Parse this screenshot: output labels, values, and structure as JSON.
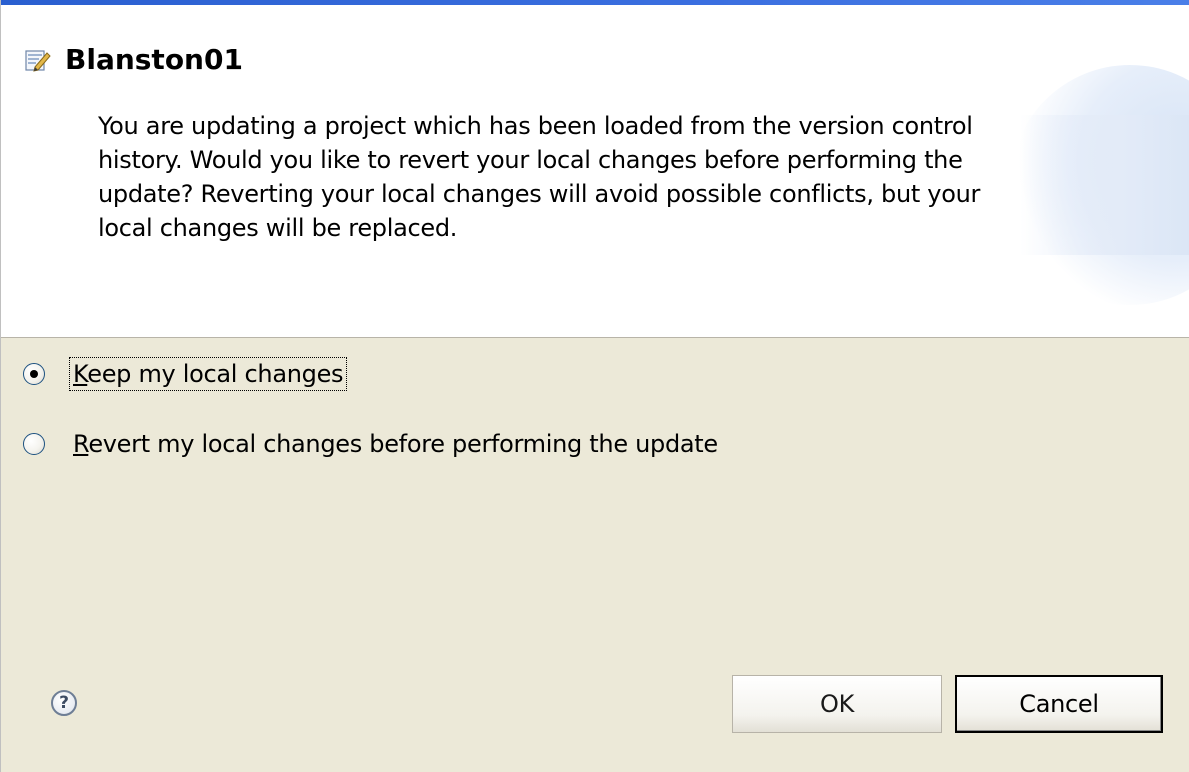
{
  "dialog": {
    "title": "Blanston01",
    "title_icon": "document-edit-icon",
    "message": "You are updating a project which has been loaded from the version control history.  Would you like to revert your local changes before performing the update? Reverting your local changes will avoid possible conflicts, but your local changes will be replaced."
  },
  "options": [
    {
      "mnemonic": "K",
      "rest": "eep my local changes",
      "selected": true
    },
    {
      "mnemonic": "R",
      "rest": "evert my local changes before performing the update",
      "selected": false
    }
  ],
  "footer": {
    "help_icon": "help-icon",
    "help_glyph": "?",
    "ok_label": "OK",
    "cancel_label": "Cancel"
  },
  "colors": {
    "header_background": "#ffffff",
    "body_background": "#ece9d8",
    "accent_bar": "#2a5fd0"
  }
}
